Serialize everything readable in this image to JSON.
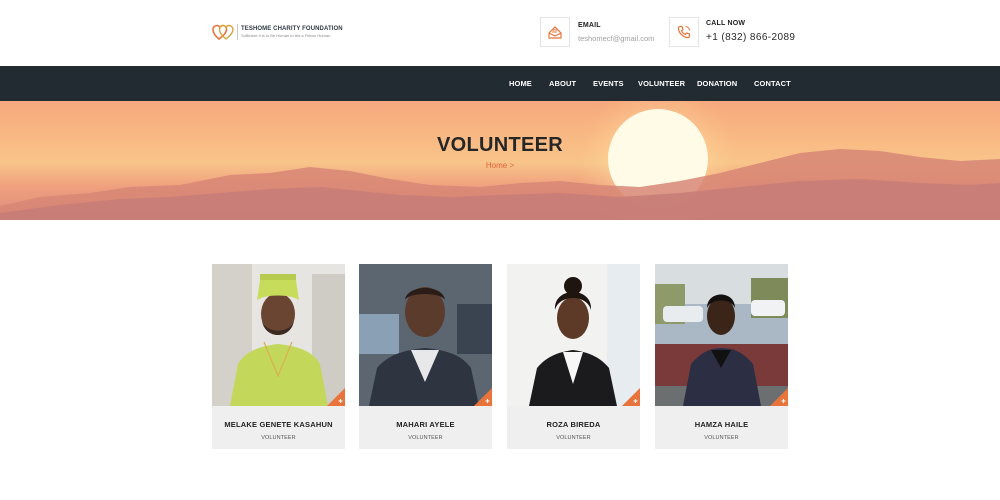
{
  "brand": {
    "name": "TESHOME CHARITY FOUNDATION",
    "tagline": "Sufficient It is to Be Human to Aid a Fellow Human",
    "accent_color": "#e8743b"
  },
  "contact": {
    "email_label": "EMAIL",
    "email_value": "teshomecf@gmail.com",
    "email_icon": "envelope-icon",
    "phone_label": "CALL NOW",
    "phone_value": "+1 (832) 866-2089",
    "phone_icon": "phone-icon"
  },
  "nav": {
    "items": [
      "HOME",
      "ABOUT",
      "EVENTS",
      "VOLUNTEER",
      "DONATION",
      "CONTACT"
    ]
  },
  "hero": {
    "title": "VOLUNTEER",
    "breadcrumb": "Home >"
  },
  "team": {
    "members": [
      {
        "name": "MELAKE GENETE KASAHUN",
        "role": "VOLUNTEER"
      },
      {
        "name": "MAHARI AYELE",
        "role": "VOLUNTEER"
      },
      {
        "name": "ROZA BIREDA",
        "role": "VOLUNTEER"
      },
      {
        "name": "HAMZA HAILE",
        "role": "VOLUNTEER"
      }
    ]
  }
}
